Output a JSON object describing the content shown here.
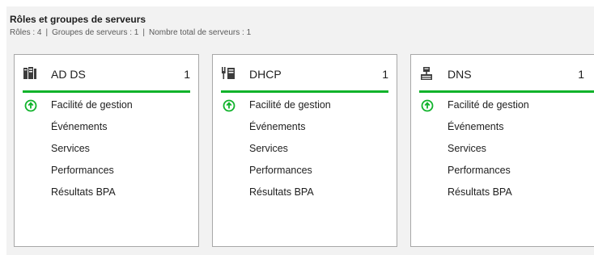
{
  "header": {
    "title": "Rôles et groupes de serveurs",
    "roles": "Rôles : 4",
    "groups": "Groupes de serveurs : 1",
    "total": "Nombre total de serveurs : 1",
    "separator": "|"
  },
  "tiles": [
    {
      "name": "AD DS",
      "count": "1",
      "icon": "ad-ds-server-icon",
      "items": [
        "Facilité de gestion",
        "Événements",
        "Services",
        "Performances",
        "Résultats BPA"
      ]
    },
    {
      "name": "DHCP",
      "count": "1",
      "icon": "dhcp-server-icon",
      "items": [
        "Facilité de gestion",
        "Événements",
        "Services",
        "Performances",
        "Résultats BPA"
      ]
    },
    {
      "name": "DNS",
      "count": "1",
      "icon": "dns-server-icon",
      "items": [
        "Facilité de gestion",
        "Événements",
        "Services",
        "Performances",
        "Résultats BPA"
      ]
    }
  ],
  "colors": {
    "status_ok": "#10b32b",
    "tile_border": "#a8a8a8",
    "panel_bg": "#f2f2f2"
  }
}
